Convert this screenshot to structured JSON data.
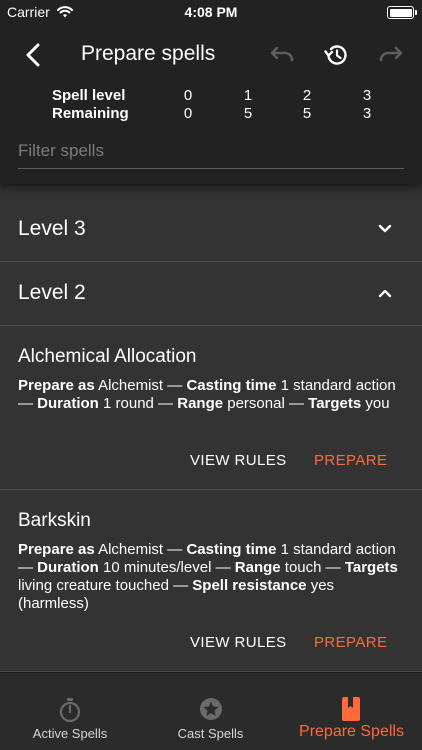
{
  "status_bar": {
    "carrier": "Carrier",
    "time": "4:08 PM"
  },
  "header": {
    "title": "Prepare spells",
    "spell_level_label": "Spell level",
    "remaining_label": "Remaining",
    "levels": [
      "0",
      "1",
      "2",
      "3"
    ],
    "remaining": [
      "0",
      "5",
      "5",
      "3"
    ],
    "filter_placeholder": "Filter spells"
  },
  "level_groups": [
    {
      "label": "Level 3",
      "expanded": false
    },
    {
      "label": "Level 2",
      "expanded": true
    }
  ],
  "labels": {
    "prepare_as": "Prepare as",
    "casting_time": "Casting time",
    "duration": "Duration",
    "range": "Range",
    "targets": "Targets",
    "spell_resistance": "Spell resistance",
    "separator": " — "
  },
  "spells": [
    {
      "name": "Alchemical Allocation",
      "prepare_as": "Alchemist",
      "casting_time": "1 standard action",
      "duration": "1 round",
      "range": "personal",
      "targets": "you",
      "view_rules": "VIEW RULES",
      "prepare": "PREPARE"
    },
    {
      "name": "Barkskin",
      "prepare_as": "Alchemist",
      "casting_time": "1 standard action",
      "duration": "10 minutes/level",
      "range": "touch",
      "targets": "living creature touched",
      "spell_resistance": "yes (harmless)",
      "view_rules": "VIEW RULES",
      "prepare": "PREPARE"
    }
  ],
  "tabs": [
    {
      "label": "Active Spells",
      "icon": "stopwatch-icon",
      "active": false
    },
    {
      "label": "Cast Spells",
      "icon": "star-badge-icon",
      "active": false
    },
    {
      "label": "Prepare Spells",
      "icon": "spellbook-icon",
      "active": true
    }
  ],
  "colors": {
    "accent": "#ff6a3d",
    "header_bg": "#222222",
    "body_bg": "#333333",
    "tabbar_bg": "#2b2b2b",
    "inactive_icon": "#6a6a6a"
  }
}
